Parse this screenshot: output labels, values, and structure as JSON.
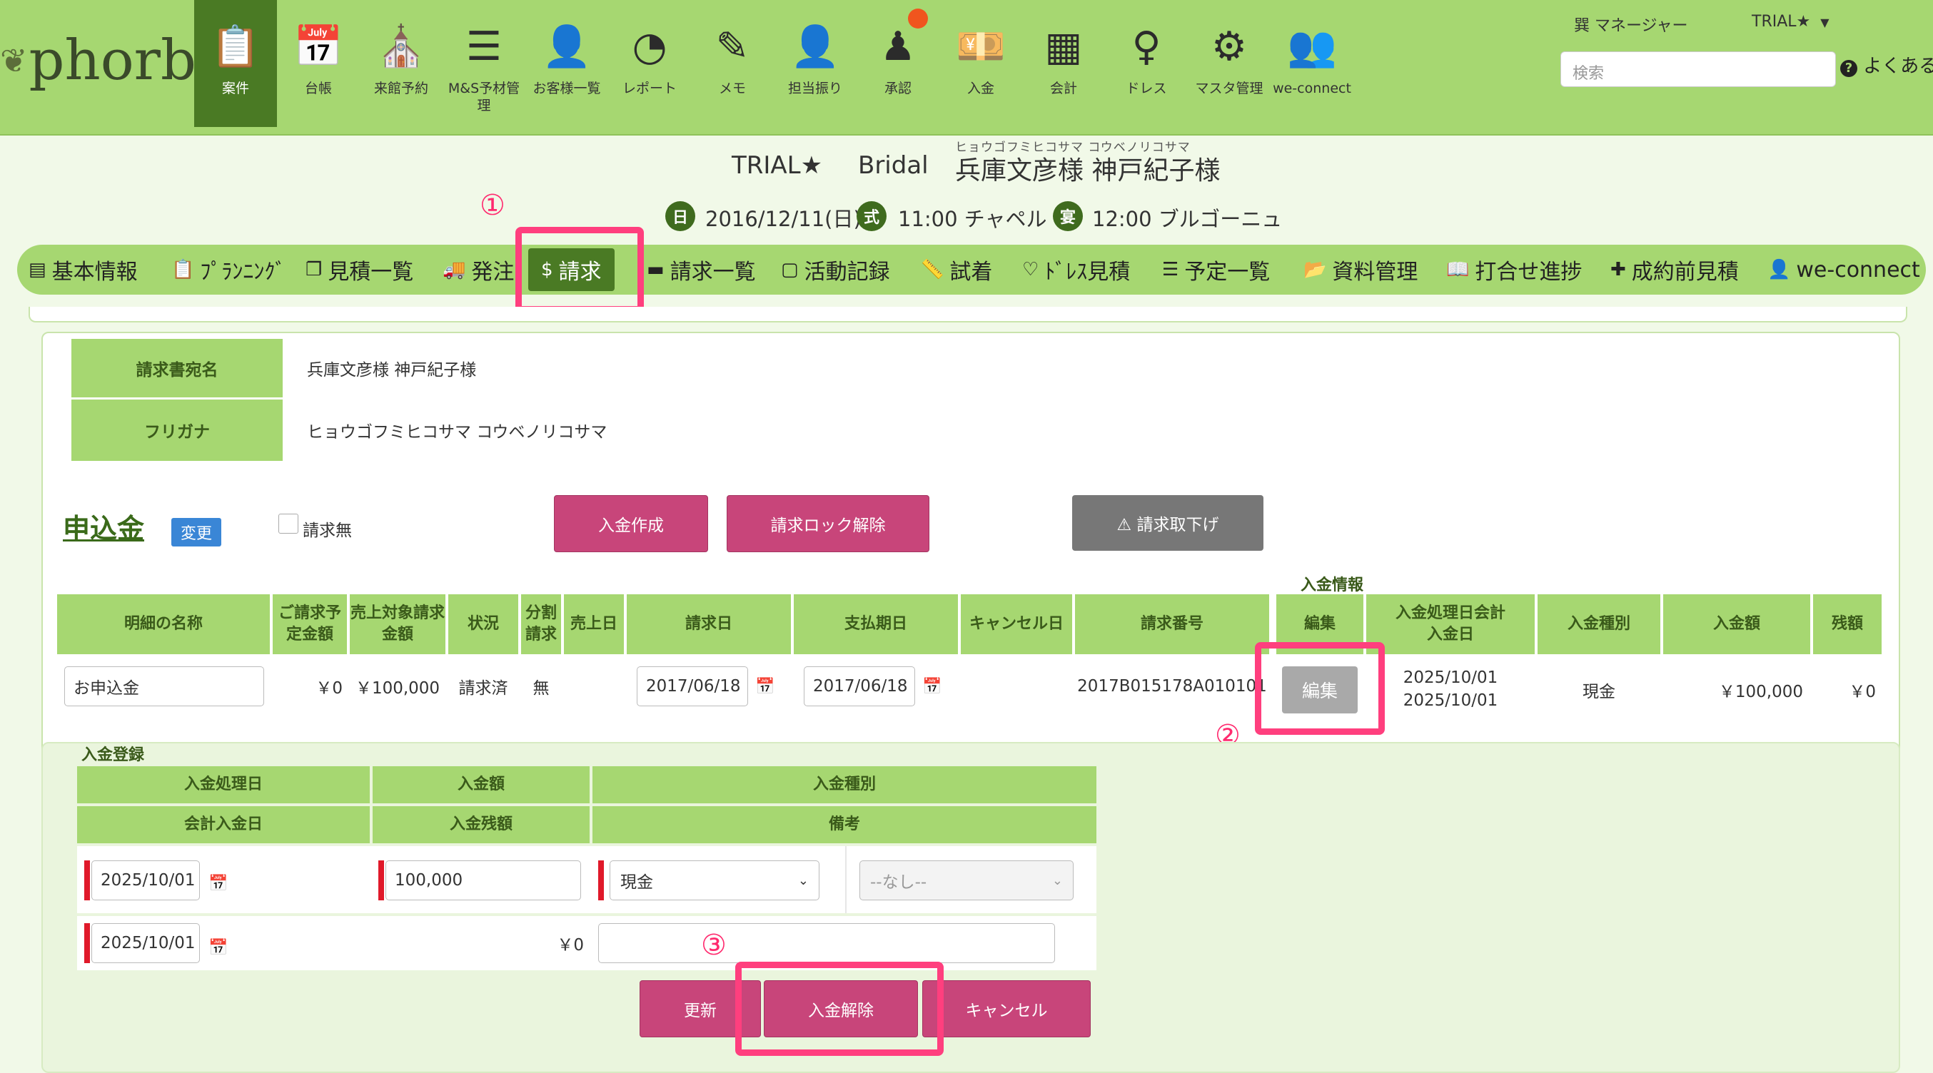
{
  "nav": {
    "logo": "phorbs",
    "items": [
      {
        "label": "案件",
        "icon": "clipboard-icon"
      },
      {
        "label": "台帳",
        "icon": "calendar-icon"
      },
      {
        "label": "来館予約",
        "icon": "church-icon"
      },
      {
        "label": "M&S予材管理",
        "icon": "list-icon"
      },
      {
        "label": "お客様一覧",
        "icon": "address-card-icon"
      },
      {
        "label": "レポート",
        "icon": "pie-chart-icon"
      },
      {
        "label": "メモ",
        "icon": "pencil-icon"
      },
      {
        "label": "担当振り",
        "icon": "user-plus-icon"
      },
      {
        "label": "承認",
        "icon": "stamp-icon"
      },
      {
        "label": "入金",
        "icon": "money-icon"
      },
      {
        "label": "会計",
        "icon": "calculator-icon"
      },
      {
        "label": "ドレス",
        "icon": "dress-icon"
      },
      {
        "label": "マスタ管理",
        "icon": "gear-icon"
      },
      {
        "label": "we-connect",
        "icon": "users-gear-icon"
      }
    ],
    "manager": "巽 マネージャー",
    "trial": "TRIAL★",
    "search_placeholder": "検索",
    "faq": "よくある"
  },
  "header": {
    "trial": "TRIAL★",
    "type": "Bridal",
    "ruby": "ヒョウゴフミヒコサマ コウベノリコサマ",
    "names": "兵庫文彦様 神戸紀子様",
    "date_badge": "日",
    "date": "2016/12/11(日)",
    "ceremony_badge": "式",
    "ceremony": "11:00 チャペル",
    "reception_badge": "宴",
    "reception": "12:00 ブルゴーニュ"
  },
  "tabs": [
    {
      "label": "基本情報",
      "icon": "id-card-icon"
    },
    {
      "label": "ﾌﾟﾗﾝﾆﾝｸﾞ",
      "icon": "clipboard-icon"
    },
    {
      "label": "見積一覧",
      "icon": "copy-icon"
    },
    {
      "label": "発注",
      "icon": "truck-icon"
    },
    {
      "label": "請求",
      "icon": "invoice-icon"
    },
    {
      "label": "請求一覧",
      "icon": "list-card-icon"
    },
    {
      "label": "活動記録",
      "icon": "comment-icon"
    },
    {
      "label": "試着",
      "icon": "ruler-icon"
    },
    {
      "label": "ﾄﾞﾚｽ見積",
      "icon": "heart-icon"
    },
    {
      "label": "予定一覧",
      "icon": "list-icon"
    },
    {
      "label": "資料管理",
      "icon": "folder-icon"
    },
    {
      "label": "打合せ進捗",
      "icon": "book-icon"
    },
    {
      "label": "成約前見積",
      "icon": "file-plus-icon"
    },
    {
      "label": "we-connect",
      "icon": "user-icon"
    }
  ],
  "markers": {
    "one": "①",
    "two": "②",
    "three": "③"
  },
  "invoice": {
    "addressee_label": "請求書宛名",
    "addressee": "兵庫文彦様 神戸紀子様",
    "furigana_label": "フリガナ",
    "furigana": "ヒョウゴフミヒコサマ コウベノリコサマ"
  },
  "section": {
    "title": "申込金",
    "change": "変更",
    "no_invoice": "請求無",
    "create_payment": "入金作成",
    "unlock": "請求ロック解除",
    "withdraw": "⚠ 請求取下げ",
    "payment_info": "入金情報"
  },
  "table": {
    "headers": [
      "明細の名称",
      "ご請求予定金額",
      "売上対象請求金額",
      "状況",
      "分割請求",
      "売上日",
      "請求日",
      "支払期日",
      "キャンセル日",
      "請求番号",
      "編集",
      "入金処理日会計入金日",
      "入金種別",
      "入金額",
      "残額"
    ],
    "row": {
      "name": "お申込金",
      "planned": "￥0",
      "amount": "￥100,000",
      "status": "請求済",
      "split": "無",
      "sales_date": "",
      "invoice_date": "2017/06/18",
      "due_date": "2017/06/18",
      "cancel_date": "",
      "number": "2017B015178A010101",
      "edit": "編集",
      "process_date": "2025/10/01",
      "account_date": "2025/10/01",
      "payment_type": "現金",
      "paid": "￥100,000",
      "balance": "￥0"
    }
  },
  "register": {
    "title": "入金登録",
    "h_process_date": "入金処理日",
    "h_amount": "入金額",
    "h_type": "入金種別",
    "h_account_date": "会計入金日",
    "h_balance": "入金残額",
    "h_note": "備考",
    "process_date": "2025/10/01",
    "amount": "100,000",
    "type": "現金",
    "subtype": "--なし--",
    "account_date": "2025/10/01",
    "balance": "￥0",
    "update": "更新",
    "release": "入金解除",
    "cancel": "キャンセル"
  }
}
